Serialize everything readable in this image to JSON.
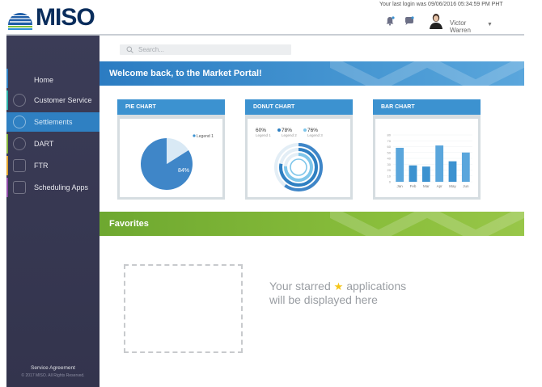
{
  "brand": {
    "name": "MISO"
  },
  "header": {
    "last_login": "Your last login was 09/06/2016 05:34:59 PM PHT",
    "user_first": "Victor",
    "user_last": "Warren",
    "icons": [
      "bell-icon",
      "chat-icon",
      "avatar",
      "chevron-down-icon"
    ]
  },
  "search": {
    "placeholder": "Search..."
  },
  "sidebar": {
    "items": [
      {
        "label": "Home",
        "icon": "home",
        "active": false
      },
      {
        "label": "Customer Service",
        "icon": "headset-icon",
        "active": false
      },
      {
        "label": "Settlements",
        "icon": "settlements-icon",
        "active": true
      },
      {
        "label": "DART",
        "icon": "dart-icon",
        "active": false
      },
      {
        "label": "FTR",
        "icon": "ftr-icon",
        "active": false
      },
      {
        "label": "Scheduling Apps",
        "icon": "calendar-icon",
        "active": false
      }
    ],
    "footer_link": "Service Agreement",
    "copyright": "© 2017 MISO. All Rights Reserved."
  },
  "welcome": {
    "title": "Welcome back, to the Market Portal!"
  },
  "cards": {
    "pie": {
      "title": "PIE CHART"
    },
    "donut": {
      "title": "DONUT CHART"
    },
    "bar": {
      "title": "BAR CHART"
    }
  },
  "favorites": {
    "title": "Favorites",
    "message_part1": "Your starred",
    "message_part2": "applications",
    "message_part3": "will  be displayed here"
  },
  "colors": {
    "primary_blue": "#2f80c2",
    "favorites_green": "#8bbf3c",
    "sidebar_bg": "#3b3c57",
    "brand_navy": "#0a2d5c"
  },
  "chart_data": [
    {
      "type": "pie",
      "title": "PIE CHART",
      "slices": [
        {
          "label": "84%",
          "value": 84
        },
        {
          "value": 16
        }
      ],
      "legend": [
        "Legend 1"
      ]
    },
    {
      "type": "pie",
      "title": "DONUT CHART",
      "rings": [
        {
          "name": "Legend 1",
          "value": 60,
          "label": "60%"
        },
        {
          "name": "Legend 2",
          "value": 78,
          "label": "78%"
        },
        {
          "name": "Legend 3",
          "value": 76,
          "label": "76%"
        }
      ]
    },
    {
      "type": "bar",
      "title": "BAR CHART",
      "categories": [
        "Jan",
        "Feb",
        "Mar",
        "Apr",
        "May",
        "Jun"
      ],
      "values": [
        58,
        28,
        26,
        62,
        35,
        50
      ],
      "ylim": [
        0,
        80
      ]
    }
  ]
}
